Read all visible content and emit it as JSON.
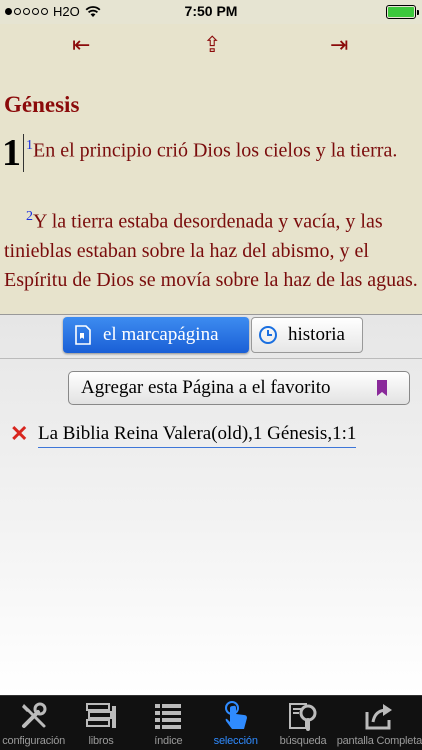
{
  "status": {
    "carrier": "H2O",
    "time": "7:50 PM",
    "signal_dots_full": 1,
    "battery_level": 1.0,
    "battery_color": "#3cc83c"
  },
  "reader": {
    "nav_first_icon": "⇤",
    "nav_up_icon": "⇪",
    "nav_last_icon": "⇥",
    "book_title": "Génesis",
    "chapter_number": "1",
    "verse1_number": "1",
    "verse1_text": "En el principio crió Dios los cielos y la tierra.",
    "verse2_number": "2",
    "verse2_text": "Y la tierra estaba desordenada y vacía, y las tinieblas estaban sobre la haz del abismo, y el Espíritu de Dios se movía sobre la haz de las aguas."
  },
  "panel": {
    "tabs": [
      {
        "label": "el marcapágina",
        "icon": "bookmark-page-icon",
        "active": true
      },
      {
        "label": "historia",
        "icon": "clock-icon",
        "active": false
      }
    ],
    "add_button_label": "Agregar esta Página a el favorito",
    "favorites": [
      {
        "label": "La Biblia Reina Valera(old),1 Génesis,1:1"
      }
    ]
  },
  "tabbar": {
    "items": [
      {
        "label": "configuración",
        "icon": "tools-icon",
        "active": false
      },
      {
        "label": "libros",
        "icon": "books-icon",
        "active": false
      },
      {
        "label": "índice",
        "icon": "list-icon",
        "active": false
      },
      {
        "label": "selección",
        "icon": "tap-hand-icon",
        "active": true
      },
      {
        "label": "búsqueda",
        "icon": "magnifier-icon",
        "active": false
      },
      {
        "label": "pantalla Completa",
        "icon": "share-arrow-icon",
        "active": false
      }
    ],
    "active_color": "#2f8bff",
    "inactive_color": "#9a9a9a"
  }
}
